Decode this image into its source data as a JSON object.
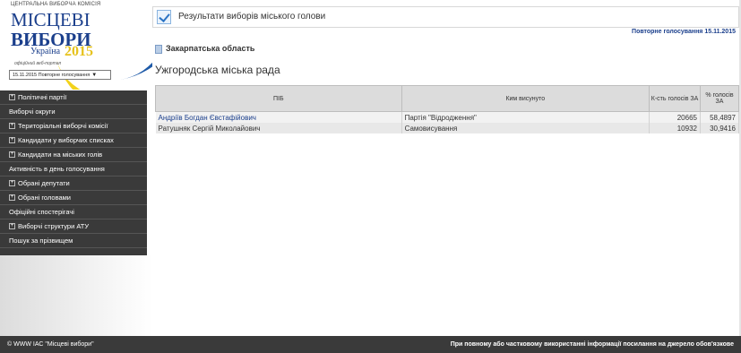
{
  "header": {
    "cvk": "ЦЕНТРАЛЬНА ВИБОРЧА КОМІСІЯ",
    "title_line1": "МІСЦЕВІ",
    "title_line2": "ВИБОРИ",
    "country": "Україна",
    "year": "2015",
    "portal": "офіційний веб-портал",
    "date_select": "15.11.2015 Повторне голосування"
  },
  "sidebar": {
    "items": [
      {
        "label": "Політичні партії",
        "expandable": true
      },
      {
        "label": "Виборчі округи",
        "expandable": false
      },
      {
        "label": "Територіальні виборчі комісії",
        "expandable": true
      },
      {
        "label": "Кандидати у виборчих списках",
        "expandable": true
      },
      {
        "label": "Кандидати на міських голів",
        "expandable": true
      },
      {
        "label": "Активність в день голосування",
        "expandable": false
      },
      {
        "label": "Обрані депутати",
        "expandable": true
      },
      {
        "label": "Обрані головами",
        "expandable": true
      },
      {
        "label": "Офіційні спостерігачі",
        "expandable": false
      },
      {
        "label": "Виборчі структури АТУ",
        "expandable": true
      },
      {
        "label": "Пошук за прізвищем",
        "expandable": false
      }
    ]
  },
  "main": {
    "title": "Результати виборів міського голови",
    "repeat_vote": "Повторне голосування 15.11.2015",
    "region": "Закарпатська область",
    "council": "Ужгородська міська рада",
    "table": {
      "headers": [
        "ПІБ",
        "Ким висунуто",
        "К-сть голосів ЗА",
        "% голосів ЗА"
      ],
      "rows": [
        [
          "Андріїв Богдан Євстафійович",
          "Партія \"Відродження\"",
          "20665",
          "58,4897"
        ],
        [
          "Ратушняк Сергій Миколайович",
          "Самовисування",
          "10932",
          "30,9416"
        ]
      ]
    }
  },
  "footer": {
    "left": "© WWW ІАС \"Місцеві вибори\"",
    "right": "При повному або частковому використанні інформації посилання на джерело обов'язкове"
  }
}
